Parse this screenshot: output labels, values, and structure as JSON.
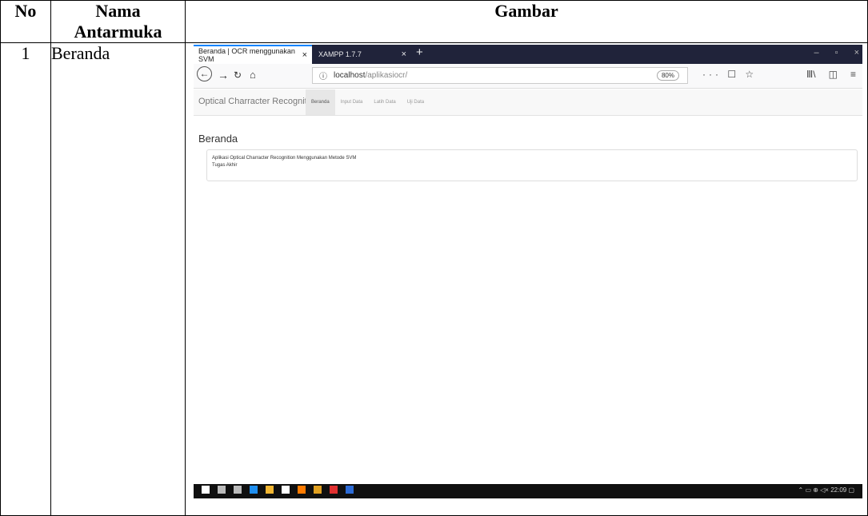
{
  "table": {
    "headers": {
      "no": "No",
      "name": "Nama Antarmuka",
      "image": "Gambar"
    },
    "rows": [
      {
        "no": "1",
        "name": "Beranda"
      }
    ]
  },
  "browser": {
    "tabs": [
      {
        "title": "Beranda | OCR menggunakan SVM",
        "active": true,
        "close": "×"
      },
      {
        "title": "XAMPP 1.7.7",
        "active": false,
        "close": "×"
      }
    ],
    "new_tab": "+",
    "window_controls": [
      "–",
      "▫",
      "×"
    ],
    "url_host": "localhost",
    "url_path": "/aplikasiocr/",
    "url_info_icon": "ⓘ",
    "zoom": "80%",
    "page_actions": "··· ☐ ☆",
    "toolbar_right": [
      "Ⅲ\\",
      "◫",
      "≡"
    ]
  },
  "app": {
    "brand": "Optical Charracter Recognition",
    "nav": [
      "Beranda",
      "Input Data",
      "Latih Data",
      "Uji Data"
    ],
    "active_nav": "Beranda",
    "heading": "Beranda",
    "panel_line1": "Aplikasi Optical Charracter Recognition Menggunakan Metode SVM",
    "panel_line2": "Tugas Akhir"
  },
  "taskbar": {
    "icon_colors": [
      "#ffffff",
      "#bbbbbb",
      "#bbbbbb",
      "#1f8ff0",
      "#f2b632",
      "#ffffff",
      "#ff7b00",
      "#e0a020",
      "#e03030",
      "#2c6bd6"
    ],
    "tray": "⌃ ▭ ⊕ ◁× 22:09 ▢"
  }
}
